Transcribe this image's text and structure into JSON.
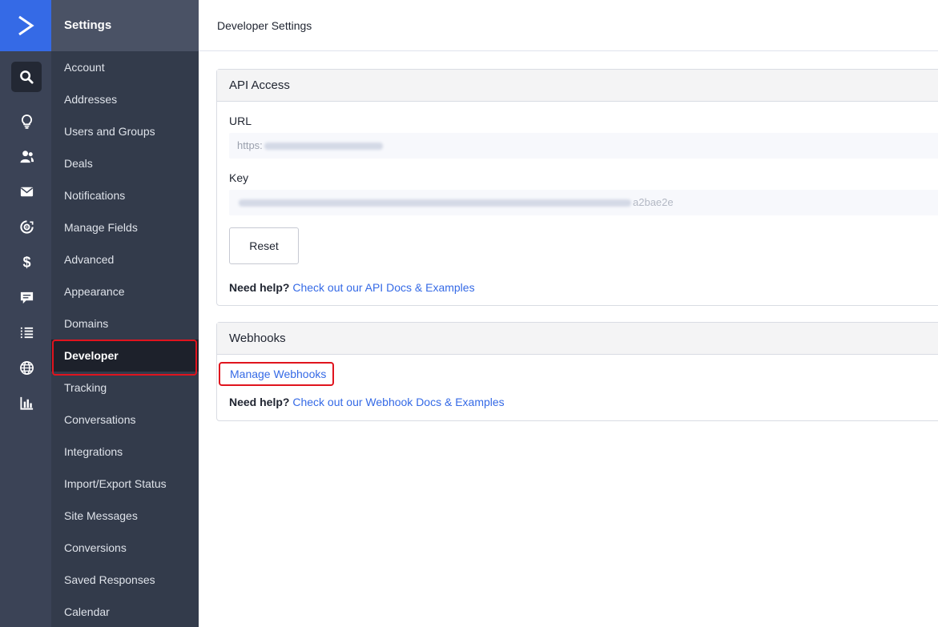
{
  "rail": {
    "icons": [
      "logo-arrow-icon",
      "search-icon",
      "lightbulb-icon",
      "contacts-icon",
      "mail-icon",
      "automations-icon",
      "dollar-icon",
      "chat-icon",
      "list-icon",
      "globe-icon",
      "reports-icon"
    ]
  },
  "sidebar": {
    "title": "Settings",
    "items": [
      {
        "label": "Account"
      },
      {
        "label": "Addresses"
      },
      {
        "label": "Users and Groups"
      },
      {
        "label": "Deals"
      },
      {
        "label": "Notifications"
      },
      {
        "label": "Manage Fields"
      },
      {
        "label": "Advanced"
      },
      {
        "label": "Appearance"
      },
      {
        "label": "Domains"
      },
      {
        "label": "Developer"
      },
      {
        "label": "Tracking"
      },
      {
        "label": "Conversations"
      },
      {
        "label": "Integrations"
      },
      {
        "label": "Import/Export Status"
      },
      {
        "label": "Site Messages"
      },
      {
        "label": "Conversions"
      },
      {
        "label": "Saved Responses"
      },
      {
        "label": "Calendar"
      }
    ],
    "active_item": "Developer"
  },
  "header": {
    "title": "Developer Settings"
  },
  "api_access": {
    "title": "API Access",
    "url_label": "URL",
    "url_value_prefix": "https:",
    "key_label": "Key",
    "key_value_suffix": "a2bae2e",
    "reset_label": "Reset",
    "help_label": "Need help?",
    "help_link": "Check out our API Docs & Examples"
  },
  "webhooks": {
    "title": "Webhooks",
    "manage_link": "Manage Webhooks",
    "help_label": "Need help?",
    "help_link": "Check out our Webhook Docs & Examples"
  },
  "colors": {
    "accent": "#356ae6",
    "rail_bg": "#3b4356",
    "sidebar_bg": "#333b4b",
    "active_bg": "#1d212b",
    "highlight": "#e0141e"
  }
}
